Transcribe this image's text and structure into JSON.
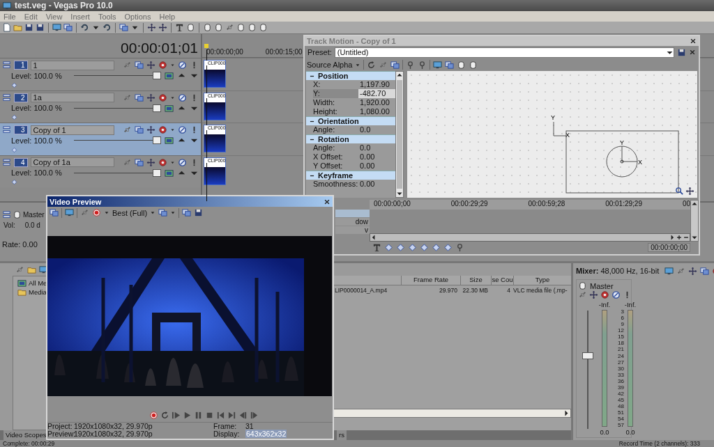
{
  "window": {
    "title": "test.veg - Vegas Pro 10.0"
  },
  "menu": [
    "File",
    "Edit",
    "View",
    "Insert",
    "Tools",
    "Options",
    "Help"
  ],
  "timeline": {
    "time": "00:00:01;01",
    "ruler": [
      "00:00:00;00",
      "00:00:15;00"
    ],
    "tracks": [
      {
        "number": "1",
        "name": "1",
        "level_label": "Level: 100.0 %",
        "level": 1,
        "selected": false,
        "clip": "CLIP000"
      },
      {
        "number": "2",
        "name": "1a",
        "level_label": "Level: 100.0 %",
        "level": 1,
        "selected": false,
        "clip": "CLIP000"
      },
      {
        "number": "3",
        "name": "Copy of 1",
        "level_label": "Level: 100.0 %",
        "level": 1,
        "selected": true,
        "clip": "CLIP000"
      },
      {
        "number": "4",
        "name": "Copy of 1a",
        "level_label": "Level: 100.0 %",
        "level": 1,
        "selected": false,
        "clip": "CLIP000"
      }
    ]
  },
  "master_bus": {
    "name": "Master",
    "vol_label": "Vol:",
    "vol": "0.0 d",
    "rate": "Rate: 0.00"
  },
  "track_motion": {
    "title": "Track Motion - Copy of 1",
    "preset_label": "Preset:",
    "preset": "(Untitled)",
    "source": "Source Alpha",
    "sections": [
      {
        "title": "Position",
        "expanded": true,
        "rows": [
          {
            "label": "X:",
            "value": "1,197.90",
            "selected": false
          },
          {
            "label": "Y:",
            "value": "-482.70",
            "selected": true
          },
          {
            "label": "Width:",
            "value": "1,920.00",
            "selected": false
          },
          {
            "label": "Height:",
            "value": "1,080.00",
            "selected": false
          }
        ]
      },
      {
        "title": "Orientation",
        "expanded": true,
        "rows": [
          {
            "label": "Angle:",
            "value": "0.0",
            "selected": false
          }
        ]
      },
      {
        "title": "Rotation",
        "expanded": true,
        "rows": [
          {
            "label": "Angle:",
            "value": "0.0",
            "selected": false
          },
          {
            "label": "X Offset:",
            "value": "0.00",
            "selected": false
          },
          {
            "label": "Y Offset:",
            "value": "0.00",
            "selected": false
          }
        ]
      },
      {
        "title": "Keyframe",
        "expanded": true,
        "rows": [
          {
            "label": "Smoothness:",
            "value": "0.00",
            "selected": false
          }
        ]
      }
    ],
    "canvas": {
      "axis_labels": [
        "Y",
        "X"
      ],
      "frame_labels": [
        "Y",
        "X"
      ]
    },
    "ruler": [
      "00:00:00;00",
      "00:00:29;29",
      "00:00:59;28",
      "00:01:29;29",
      "00"
    ],
    "track_rows": [
      {
        "selected": true
      },
      {
        "label": "dow",
        "selected": false
      },
      {
        "label": "v",
        "selected": false
      }
    ],
    "time": "00:00:00;00"
  },
  "video_preview": {
    "title": "Video Preview",
    "quality": "Best (Full)",
    "info": [
      {
        "label": "Project:",
        "value": "1920x1080x32, 29.970p"
      },
      {
        "label": "Preview:",
        "value": "1920x1080x32, 29.970p"
      },
      {
        "label": "Frame:",
        "value": "31"
      },
      {
        "label": "Display:",
        "value": "643x362x32"
      }
    ]
  },
  "explorer": {
    "tree": [
      "All Me",
      "Media"
    ],
    "columns": [
      "Frame Rate",
      "Size",
      "se Cou",
      "Type"
    ],
    "rows": [
      {
        "name": "LIP0000014_A.mp4",
        "cells": [
          "29.970",
          "22.30 MB",
          "4",
          "VLC media file (.mp-"
        ]
      }
    ],
    "tabs": [
      "Video Scopes",
      "rs"
    ]
  },
  "mixer": {
    "title": "Mixer:",
    "format": "48,000 Hz, 16-bit",
    "channel": "Master",
    "peaks": [
      "-Inf.",
      "-Inf."
    ],
    "scale": [
      "3",
      "6",
      "9",
      "12",
      "15",
      "18",
      "21",
      "24",
      "27",
      "30",
      "33",
      "36",
      "39",
      "42",
      "45",
      "48",
      "51",
      "54",
      "57"
    ],
    "readings": [
      "0.0",
      "0.0"
    ],
    "level": 0.62
  },
  "status_bar": [
    "Complete: 00:00:29",
    "Record Time (2 channels): 333"
  ]
}
